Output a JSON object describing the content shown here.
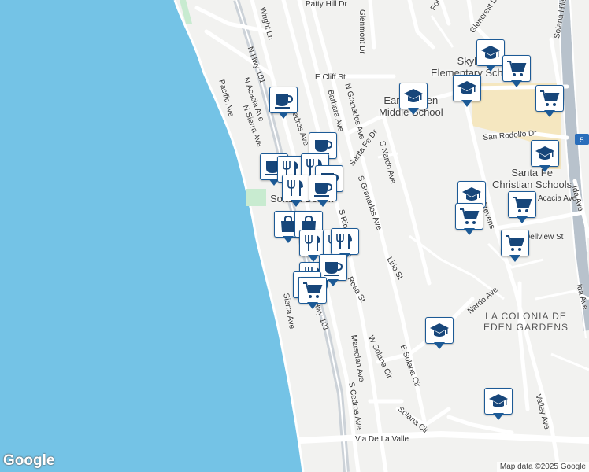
{
  "map": {
    "google_logo": "Google",
    "attribution": "Map data ©2025 Google",
    "area_label": "LA COLONIA DE EDEN GARDENS",
    "street_labels": [
      {
        "text": "Patty Hill Dr"
      },
      {
        "text": "Wright Ln"
      },
      {
        "text": "Glenmont Dr"
      },
      {
        "text": "Ford P"
      },
      {
        "text": "Glencrest D"
      },
      {
        "text": "Solana Hills D"
      },
      {
        "text": "N Hwy 101"
      },
      {
        "text": "E Cliff St"
      },
      {
        "text": "N Granados Ave"
      },
      {
        "text": "Pacific Ave"
      },
      {
        "text": "N Acacia Ave"
      },
      {
        "text": "N Sierra Ave"
      },
      {
        "text": "N Cedros Ave"
      },
      {
        "text": "Barbara Ave"
      },
      {
        "text": "Santa Fe Dr"
      },
      {
        "text": "S Nardo Ave"
      },
      {
        "text": "San Rodolfo Dr"
      },
      {
        "text": "S Granados Ave"
      },
      {
        "text": "S Rios Ave"
      },
      {
        "text": "Lirio St"
      },
      {
        "text": "Stevens"
      },
      {
        "text": "Ida Ave"
      },
      {
        "text": "Dellview St"
      },
      {
        "text": "Ida Ave"
      },
      {
        "text": "Nardo Ave"
      },
      {
        "text": "Sierra Ave"
      },
      {
        "text": "Hwy 101"
      },
      {
        "text": "Rosa St"
      },
      {
        "text": "Marsolan Ave"
      },
      {
        "text": "W Solana Cir"
      },
      {
        "text": "E Solana Cir"
      },
      {
        "text": "S Cedros Ave"
      },
      {
        "text": "Solana Cir"
      },
      {
        "text": "Valley Ave"
      },
      {
        "text": "Via De La Valle"
      },
      {
        "text": "Acacia Ave"
      }
    ],
    "place_labels": [
      {
        "text": "Skyline Elementary School"
      },
      {
        "text": "Earl Warren Middle School"
      },
      {
        "text": "Santa Fe Christian Schools"
      },
      {
        "text": "Solana Beach"
      }
    ],
    "highway_shield": "5",
    "markers": [
      {
        "icon": "coffee-icon"
      },
      {
        "icon": "school-icon"
      },
      {
        "icon": "school-icon"
      },
      {
        "icon": "shopping-cart-icon"
      },
      {
        "icon": "school-icon"
      },
      {
        "icon": "school-icon"
      },
      {
        "icon": "shopping-cart-icon"
      },
      {
        "icon": "shopping-cart-icon"
      },
      {
        "icon": "school-icon"
      },
      {
        "icon": "shopping-cart-icon"
      },
      {
        "icon": "shopping-cart-icon"
      },
      {
        "icon": "school-icon"
      },
      {
        "icon": "school-icon"
      },
      {
        "icon": "coffee-icon"
      },
      {
        "icon": "restaurant-icon"
      },
      {
        "icon": "coffee-icon"
      },
      {
        "icon": "restaurant-icon"
      },
      {
        "icon": "coffee-icon"
      },
      {
        "icon": "restaurant-icon"
      },
      {
        "icon": "coffee-icon"
      },
      {
        "icon": "shopping-bag-icon"
      },
      {
        "icon": "shopping-bag-icon"
      },
      {
        "icon": "restaurant-icon"
      },
      {
        "icon": "restaurant-icon"
      },
      {
        "icon": "restaurant-icon"
      },
      {
        "icon": "restaurant-icon"
      },
      {
        "icon": "coffee-icon"
      },
      {
        "icon": "restaurant-icon"
      },
      {
        "icon": "shopping-cart-icon"
      }
    ],
    "colors": {
      "ocean": "#74c3e6",
      "land": "#f2f2f0",
      "park": "#c8ebd0",
      "campus": "#f5e7c0",
      "highway": "#b8c2cc",
      "marker_border": "#1c5a96",
      "marker_icon": "#17467a"
    }
  }
}
